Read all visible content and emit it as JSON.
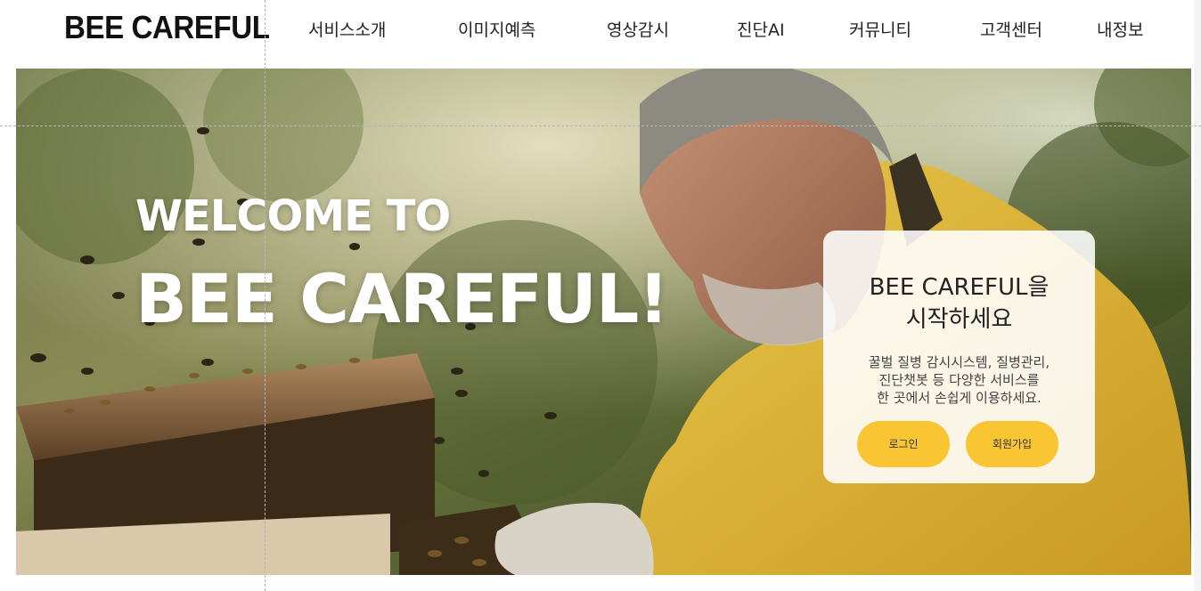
{
  "header": {
    "logo": "BEE CAREFUL",
    "nav": [
      "서비스소개",
      "이미지예측",
      "영상감시",
      "진단AI",
      "커뮤니티",
      "고객센터",
      "내정보"
    ]
  },
  "hero": {
    "welcome_line": "WELCOME TO",
    "brand_line": "BEE CAREFUL!",
    "image_subject": "beekeeper-with-beehive-photo"
  },
  "card": {
    "title_line1": "BEE CAREFUL을",
    "title_line2": "시작하세요",
    "desc_line1": "꿀벌 질병 감시시스템, 질병관리,",
    "desc_line2": "진단챗봇 등 다양한 서비스를",
    "desc_line3": "한 곳에서 손쉽게 이용하세요.",
    "login_label": "로그인",
    "signup_label": "회원가입"
  },
  "colors": {
    "accent": "#f9c532",
    "text": "#222222",
    "hero_text": "#ffffff"
  }
}
